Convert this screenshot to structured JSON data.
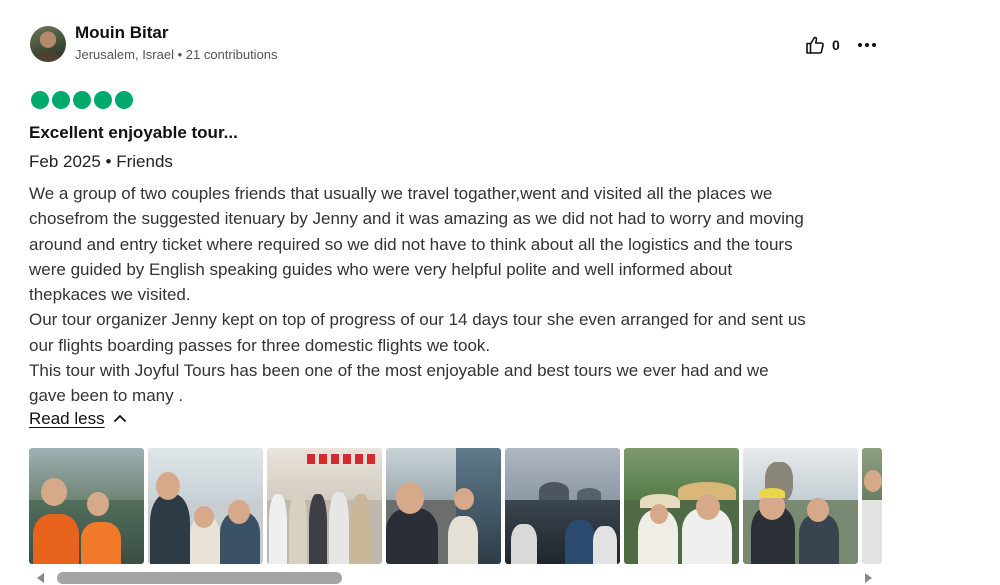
{
  "reviewer": {
    "name": "Mouin Bitar",
    "location": "Jerusalem, Israel",
    "contributions": "21 contributions",
    "meta_text": "Jerusalem, Israel • 21 contributions"
  },
  "helpful": {
    "icon": "thumbs-up-icon",
    "count": "0"
  },
  "more_icon": "more-options-icon",
  "rating": {
    "value": 5,
    "max": 5,
    "color": "#00aa6c"
  },
  "review": {
    "title": "Excellent enjoyable tour...",
    "date_line": "Feb 2025 • Friends",
    "body_lines": [
      "We a group of two couples friends that usually we travel togather,went and visited all the places we",
      "chosefrom the suggested itenuary by Jenny and it was amazing as we did not had to worry and moving",
      "around and entry ticket where required so we did not have to think about all the logistics and the tours",
      "were guided by English speaking guides who were very helpful polite and well informed about",
      "thepkaces we visited.",
      "Our tour organizer Jenny kept on top of progress of our 14 days tour she even arranged for and sent us",
      "our flights boarding passes for three domestic flights we took.",
      "This tour with Joyful Tours has been one of the most enjoyable and best tours we ever had and we",
      "gave been to many ."
    ],
    "read_less_label": "Read less",
    "read_less_icon": "chevron-up-icon"
  },
  "photos": {
    "count_visible": 8,
    "scroll_position_fraction": 0.0
  }
}
